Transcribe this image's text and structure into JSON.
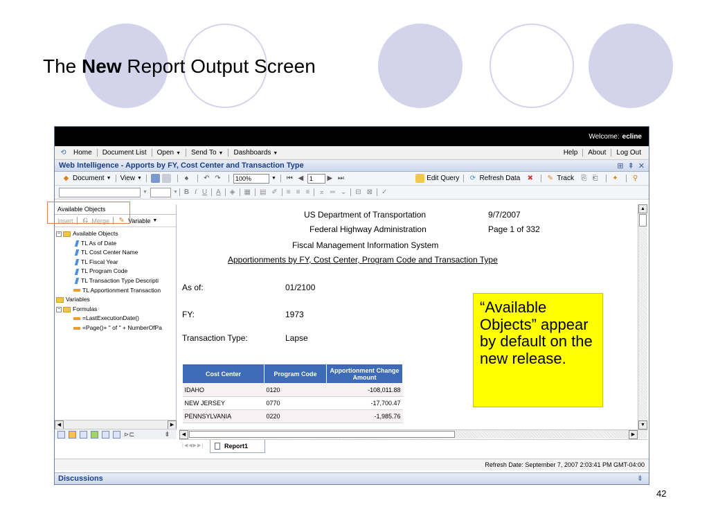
{
  "slide": {
    "title_prefix": "The ",
    "title_bold": "New",
    "title_suffix": " Report Output Screen",
    "page_number": "42",
    "callout": "“Available Objects” appear by default on the new release.",
    "colors": {
      "decorative_circles": "#d4d3ec",
      "callout_bg": "#ffff00",
      "highlight_border": "#e07a55"
    }
  },
  "app": {
    "welcome_label": "Welcome:",
    "username": "ecline",
    "nav_left": [
      "Home",
      "Document List",
      "Open",
      "Send To",
      "Dashboards"
    ],
    "nav_right": [
      "Help",
      "About",
      "Log Out"
    ],
    "window_title": "Web Intelligence - Apports by FY, Cost Center and Transaction Type",
    "toolbar": {
      "document": "Document",
      "view": "View",
      "zoom": "100%",
      "page": "1",
      "edit_query": "Edit Query",
      "refresh_data": "Refresh Data",
      "track": "Track"
    },
    "left_panel": {
      "header": "Available Objects",
      "insert": "Insert",
      "merge": "Merge",
      "variable": "Variable",
      "tree": {
        "root": "Available Objects",
        "items": [
          "TL As of Date",
          "TL Cost Center Name",
          "TL Fiscal Year",
          "TL Program Code",
          "TL Transaction Type Descripti"
        ],
        "measure": "TL Apportionment Transaction",
        "variables": "Variables",
        "formulas": "Formulas",
        "formula_items": [
          "=LastExecutionDate()",
          "=Page()+ \" of \" + NumberOfPa"
        ]
      }
    },
    "report": {
      "org": "US Department of Transportation",
      "agency": "Federal Highway Administration",
      "system": "Fiscal Management Information System",
      "heading": "Apportionments by FY, Cost Center, Program Code and Transaction Type",
      "date": "9/7/2007",
      "page_info": "Page 1 of 332",
      "as_of_label": "As of:",
      "as_of_value": "01/2100",
      "fy_label": "FY:",
      "fy_value": "1973",
      "txn_label": "Transaction Type:",
      "txn_value": "Lapse",
      "table": {
        "headers": [
          "Cost Center",
          "Program Code",
          "Apportionment Change Amount"
        ],
        "rows": [
          [
            "IDAHO",
            "0120",
            "-108,011.88"
          ],
          [
            "NEW JERSEY",
            "0770",
            "-17,700.47"
          ],
          [
            "PENNSYLVANIA",
            "0220",
            "-1,985.76"
          ]
        ]
      }
    },
    "tab": "Report1",
    "status": "Refresh Date: September 7, 2007 2:03:41 PM GMT-04:00",
    "discussions": "Discussions",
    "colors": {
      "table_header": "#3d6bb7",
      "title_text": "#1a3f86",
      "topbar": "#000000"
    }
  }
}
